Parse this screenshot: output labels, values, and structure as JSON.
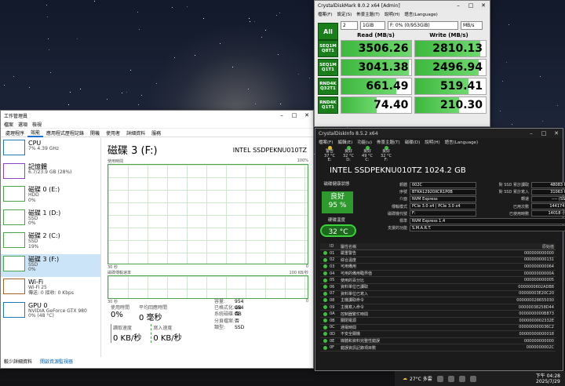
{
  "taskmgr": {
    "title": "工作管理員",
    "menu": [
      "檔案",
      "選項",
      "檢視"
    ],
    "tabs": [
      "處理程序",
      "效能",
      "應用程式歷程記錄",
      "開機",
      "使用者",
      "詳細資料",
      "服務"
    ],
    "devices": [
      {
        "name": "CPU",
        "sub1": "7% 4.39 GHz",
        "sub2": ""
      },
      {
        "name": "記憶體",
        "sub1": "6.7/23.9 GB (28%)",
        "sub2": ""
      },
      {
        "name": "磁碟 0 (E:)",
        "sub1": "HDD",
        "sub2": "0%"
      },
      {
        "name": "磁碟 1 (D:)",
        "sub1": "SSD",
        "sub2": "0%"
      },
      {
        "name": "磁碟 2 (C:)",
        "sub1": "SSD",
        "sub2": "19%"
      },
      {
        "name": "磁碟 3 (F:)",
        "sub1": "SSD",
        "sub2": "0%"
      },
      {
        "name": "Wi-Fi",
        "sub1": "Wi-Fi 25",
        "sub2": "傳送: 0 接收: 0 Kbps"
      },
      {
        "name": "GPU 0",
        "sub1": "NVIDIA GeForce GTX 980",
        "sub2": "0% (48 °C)"
      }
    ],
    "disk_title": "磁碟 3 (F:)",
    "disk_model": "INTEL SSDPEKNU010TZ",
    "graph1_label": "使用時間",
    "graph1_max": "100%",
    "graph_time": "30 秒",
    "graph_zero": "0",
    "graph2_label": "磁碟傳輸速率",
    "graph2_max": "100 KB/秒",
    "active_label": "使用時間",
    "active_val": "0%",
    "resp_label": "平均回應時間",
    "resp_val": "0 毫秒",
    "read_label": "讀取速度",
    "read_val": "0 KB/秒",
    "write_label": "寫入速度",
    "write_val": "0 KB/秒",
    "kv": [
      {
        "k": "容量:",
        "v": "954 GB"
      },
      {
        "k": "已格式化:",
        "v": "954 GB"
      },
      {
        "k": "系統磁碟:",
        "v": "否"
      },
      {
        "k": "分頁檔案:",
        "v": "否"
      },
      {
        "k": "類型:",
        "v": "SSD"
      }
    ],
    "fewer": "較少詳細資料",
    "resmon": "開啟資源監視器"
  },
  "cdm": {
    "title": "CrystalDiskMark 8.0.2 x64 [Admin]",
    "menu": [
      "檔案(F)",
      "設定(S)",
      "佈景主題(T)",
      "說明(H)",
      "語言(Language)"
    ],
    "all": "All",
    "count": "2",
    "size": "1GiB",
    "drive": "F: 0% (0/953GiB)",
    "unit": "MB/s",
    "read_h": "Read (MB/s)",
    "write_h": "Write (MB/s)",
    "rows": [
      {
        "t1": "SEQ1M",
        "t2": "Q8T1",
        "read": "3506.26",
        "write": "2810.13",
        "rf": 1.0,
        "wf": 0.92
      },
      {
        "t1": "SEQ1M",
        "t2": "Q1T1",
        "read": "3041.38",
        "write": "2496.94",
        "rf": 0.96,
        "wf": 0.9
      },
      {
        "t1": "RND4K",
        "t2": "Q32T1",
        "read": "661.49",
        "write": "519.41",
        "rf": 0.78,
        "wf": 0.75
      },
      {
        "t1": "RND4K",
        "t2": "Q1T1",
        "read": "74.40",
        "write": "210.30",
        "rf": 0.5,
        "wf": 0.62
      }
    ]
  },
  "cdi": {
    "title": "CrystalDiskInfo 8.5.2 x64",
    "menu": [
      "檔案(F)",
      "編輯(E)",
      "功能(u)",
      "佈景主題(T)",
      "磁碟(D)",
      "說明(H)",
      "語言(Language)"
    ],
    "drives": [
      {
        "status": "警告",
        "temp": "37 °C",
        "letter": "E:"
      },
      {
        "status": "良好",
        "temp": "32 °C",
        "letter": "D:"
      },
      {
        "status": "良好",
        "temp": "49 °C",
        "letter": "C:"
      },
      {
        "status": "良好",
        "temp": "32 °C",
        "letter": "F:"
      }
    ],
    "model": "INTEL SSDPEKNU010TZ 1024.2 GB",
    "health_label": "磁碟健康狀態",
    "health": "良好",
    "health_pct": "95 %",
    "temp_label": "硬碟溫度",
    "temp": "32 °C",
    "info": [
      {
        "k": "韌體",
        "v": "002C",
        "k2": "對 SSD 累計讀取",
        "v2": "48083 GB"
      },
      {
        "k": "序號",
        "v": "BTKA12920XCR1P0B",
        "k2": "對 SSD 累計寫入",
        "v2": "31063 GB"
      },
      {
        "k": "介面",
        "v": "NVM Express",
        "k2": "轉速",
        "v2": "---- (SSD)"
      },
      {
        "k": "傳輸模式",
        "v": "PCIe 3.0 x4 | PCIe 3.0 x4",
        "k2": "已用次數",
        "v2": "144174 次"
      },
      {
        "k": "磁碟機代號",
        "v": "F:",
        "k2": "已使用時數",
        "v2": "14018 小時"
      },
      {
        "k": "標準",
        "v": "NVM Express 1.4",
        "k2": "",
        "v2": ""
      },
      {
        "k": "支援的功能",
        "v": "S.M.A.R.T.",
        "k2": "",
        "v2": ""
      }
    ],
    "smart_h": {
      "id": "ID",
      "attr": "屬性名稱",
      "raw": "原始值"
    },
    "smart": [
      {
        "id": "01",
        "attr": "嚴重警告",
        "raw": "000000000000"
      },
      {
        "id": "02",
        "attr": "綜合溫度",
        "raw": "000000000131"
      },
      {
        "id": "03",
        "attr": "可用備用",
        "raw": "000000000064"
      },
      {
        "id": "04",
        "attr": "可用的備用臨界值",
        "raw": "00000000000A"
      },
      {
        "id": "05",
        "attr": "使用的百分比",
        "raw": "000000000005"
      },
      {
        "id": "06",
        "attr": "資料單位已讀取",
        "raw": "0000000602ADB8"
      },
      {
        "id": "07",
        "attr": "資料單位已寫入",
        "raw": "00000003E20C20"
      },
      {
        "id": "08",
        "attr": "主機讀取命令",
        "raw": "000000028655030"
      },
      {
        "id": "09",
        "attr": "主機寫入命令",
        "raw": "00000038258D44"
      },
      {
        "id": "0A",
        "attr": "控制器繁忙時間",
        "raw": "0000000000B873"
      },
      {
        "id": "0B",
        "attr": "關閉電源",
        "raw": "0000000002332E"
      },
      {
        "id": "0C",
        "attr": "通電時間",
        "raw": "000000000036C2"
      },
      {
        "id": "0D",
        "attr": "不安全關機",
        "raw": "00000000000018"
      },
      {
        "id": "0E",
        "attr": "媒體和資料完整性錯誤",
        "raw": "000000000000"
      },
      {
        "id": "0F",
        "attr": "錯誤資訊記錄項目數",
        "raw": "0000000002C"
      }
    ]
  },
  "tray": {
    "weather": "27°C 多雲",
    "time": "下午 04:28",
    "date": "2025/7/29"
  }
}
